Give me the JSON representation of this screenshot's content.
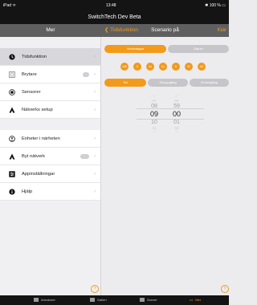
{
  "status_bar": {
    "carrier": "iPad ᯤ",
    "time": "13:48",
    "battery": "✱ 100 % ▭"
  },
  "app_title": "SwitchTech Dev Beta",
  "sidebar": {
    "title": "Mer",
    "groups": [
      {
        "items": [
          {
            "label": "Tidsfunktion",
            "icon": "clock-icon"
          },
          {
            "label": "Brytare",
            "icon": "switch-icon"
          },
          {
            "label": "Sensorer",
            "icon": "sensor-icon"
          },
          {
            "label": "Nätverks setup",
            "icon": "network-icon"
          }
        ]
      },
      {
        "items": [
          {
            "label": "Enheter i närheten",
            "icon": "nearby-icon"
          },
          {
            "label": "Byt nätverk",
            "icon": "network-icon"
          },
          {
            "label": "Appinställningar",
            "icon": "settings-icon"
          },
          {
            "label": "Hjälp",
            "icon": "info-icon"
          }
        ]
      }
    ],
    "selected": "Tidsfunktion"
  },
  "detail": {
    "back_label": "Tidsfunktion",
    "title": "Scenario på",
    "done_label": "Klar",
    "mode_tabs": [
      {
        "label": "Veckodagar",
        "active": true
      },
      {
        "label": "Datum",
        "active": false
      }
    ],
    "days": [
      "må",
      "ti",
      "on",
      "to",
      "fr",
      "lö",
      "sö"
    ],
    "trigger_tabs": [
      {
        "label": "Tid",
        "active": true
      },
      {
        "label": "Soluppgång",
        "active": false
      },
      {
        "label": "Solnedgång",
        "active": false
      }
    ],
    "time_picker": {
      "hours": [
        "06",
        "07",
        "08",
        "09",
        "10",
        "11",
        "12"
      ],
      "minutes": [
        "57",
        "58",
        "59",
        "00",
        "01",
        "02",
        "03"
      ],
      "selected_hour": "09",
      "selected_minute": "00"
    },
    "help_label": "?"
  },
  "tabbar": [
    {
      "label": "Armaturer",
      "icon": "lamp-icon",
      "active": false
    },
    {
      "label": "Gallerí",
      "icon": "gallery-icon",
      "active": false
    },
    {
      "label": "Scener",
      "icon": "scene-icon",
      "active": false
    },
    {
      "label": "Mer",
      "icon": "more-icon",
      "active": true
    }
  ],
  "colors": {
    "accent": "#f39a1a",
    "bar": "#141414",
    "header": "#5f5f5f"
  }
}
